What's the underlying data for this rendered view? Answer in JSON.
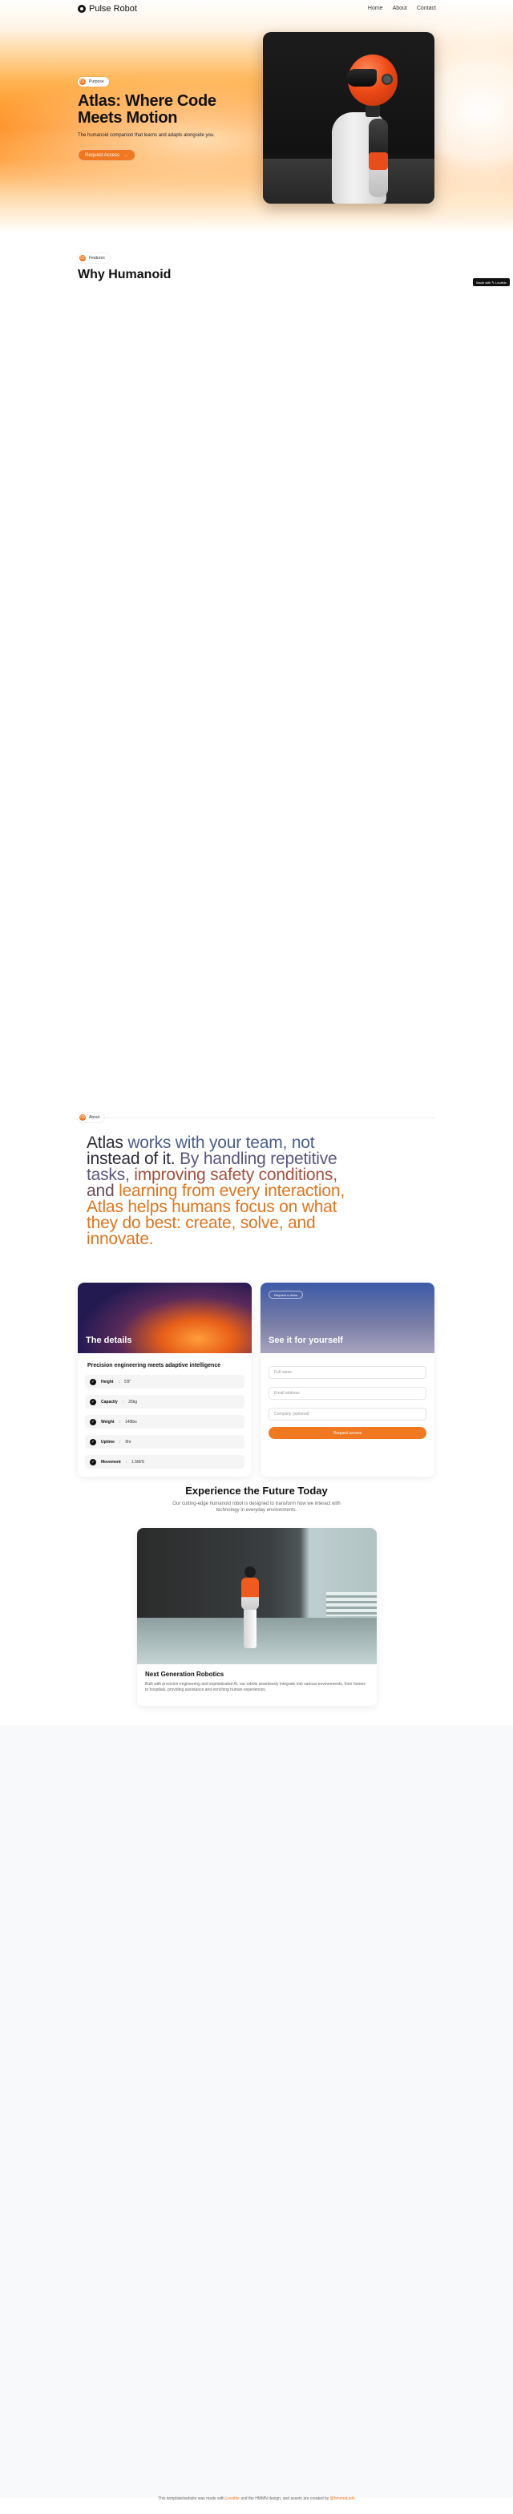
{
  "nav": {
    "brand": "Pulse Robot",
    "links": [
      "Home",
      "About",
      "Contact"
    ]
  },
  "hero": {
    "pill_number": "01",
    "pill_label": "Purpose",
    "title_line1": "Atlas: Where Code",
    "title_line2": "Meets Motion",
    "subtitle": "The humanoid companion that learns and adapts alongside you.",
    "cta_label": "Request Access",
    "cta_arrow": "→"
  },
  "why": {
    "pill_number": "02",
    "pill_label": "Features",
    "title": "Why Humanoid"
  },
  "badge": "Made with ✎ Lovable",
  "about": {
    "pill_number": "03",
    "pill_label": "About",
    "statement": [
      {
        "text": "Atlas ",
        "color": "#2b2b3a"
      },
      {
        "text": "works with your team, not",
        "color": "#4a5e8c"
      },
      {
        "text": " instead of it. ",
        "color": "#2b2b3a"
      },
      {
        "text": "By handling repetitive tasks, ",
        "color": "#5a5680"
      },
      {
        "text": "improving safety conditions, ",
        "color": "#a4503e"
      },
      {
        "text": "and ",
        "color": "#6b4a5a"
      },
      {
        "text": "learning from every interaction, Atlas helps humans focus on what they do best: create, solve, and innovate.",
        "color": "#e0741e"
      }
    ]
  },
  "details_card": {
    "title": "The details",
    "subtitle": "Precision engineering meets adaptive intelligence",
    "specs": [
      {
        "label": "Height",
        "value": "5'8\""
      },
      {
        "label": "Capacity",
        "value": "25kg"
      },
      {
        "label": "Weight",
        "value": "140lbs"
      },
      {
        "label": "Uptime",
        "value": "6hr"
      },
      {
        "label": "Movement",
        "value": "1.5M/S"
      }
    ],
    "check_glyph": "✓"
  },
  "form_card": {
    "tag": "Request a demo",
    "title": "See it for yourself",
    "fields": [
      "Full name",
      "Email address",
      "Company (optional)"
    ],
    "button": "Request access"
  },
  "experience": {
    "title": "Experience the Future Today",
    "text": "Our cutting-edge humanoid robot is designed to transform how we interact with technology in everyday environments.",
    "card_title": "Next Generation Robotics",
    "card_text": "Built with precision engineering and sophisticated AI, our robots seamlessly integrate into various environments, from homes to hospitals, providing assistance and enriching human experiences."
  },
  "footer": {
    "prefix": "This template/website was made with ",
    "link1": "Lovable",
    "middle": " and the HMMN design, and assets are created by ",
    "link2": "@hmmnd.info"
  },
  "colors": {
    "accent": "#f07820",
    "hero_orange": "#ff8a1a"
  }
}
